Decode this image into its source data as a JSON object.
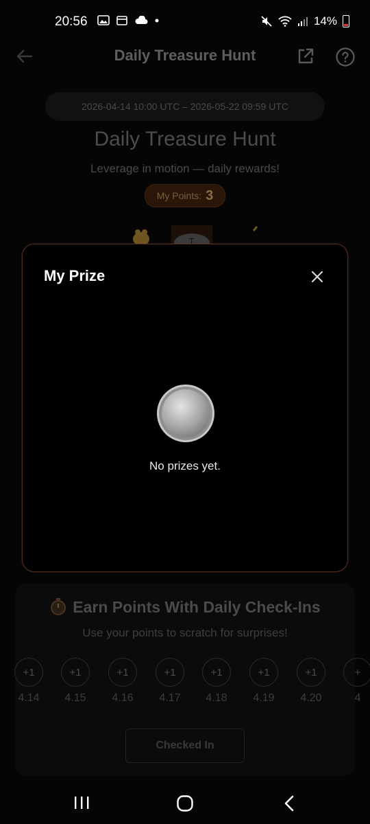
{
  "status_bar": {
    "time": "20:56",
    "battery": "14%",
    "icons": [
      "gallery-icon",
      "cloud-icon",
      "mute-icon",
      "wifi-icon",
      "signal-icon",
      "battery-icon"
    ]
  },
  "header": {
    "title": "Daily Treasure Hunt"
  },
  "event": {
    "date_range": "2026-04-14 10:00 UTC – 2026-05-22 09:59 UTC",
    "title": "Daily Treasure Hunt",
    "subtitle": "Leverage in motion — daily rewards!",
    "points_label": "My Points:",
    "points_value": "3"
  },
  "earn": {
    "title": "Earn Points With Daily Check-Ins",
    "subtitle": "Use your points to scratch for surprises!",
    "days": [
      {
        "reward": "+1",
        "date": "4.14"
      },
      {
        "reward": "+1",
        "date": "4.15"
      },
      {
        "reward": "+1",
        "date": "4.16"
      },
      {
        "reward": "+1",
        "date": "4.17"
      },
      {
        "reward": "+1",
        "date": "4.18"
      },
      {
        "reward": "+1",
        "date": "4.19"
      },
      {
        "reward": "+1",
        "date": "4.20"
      },
      {
        "reward": "+",
        "date": "4"
      }
    ],
    "button_label": "Checked In"
  },
  "modal": {
    "title": "My Prize",
    "empty_text": "No prizes yet."
  },
  "colors": {
    "modal_border": "#4a2a1e",
    "points_text": "#8c6a48"
  }
}
